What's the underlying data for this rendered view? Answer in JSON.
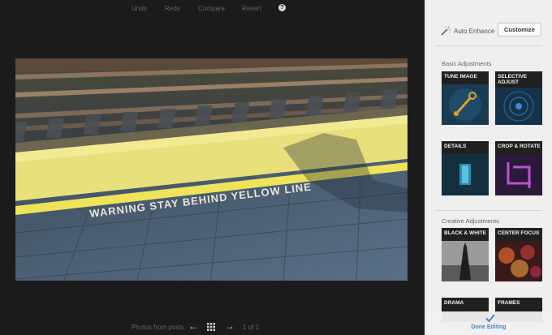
{
  "toolbar": {
    "undo": "Undo",
    "redo": "Redo",
    "compare": "Compare",
    "revert": "Revert",
    "help": "?"
  },
  "photo": {
    "stencil_text": "WARNING STAY BEHIND YELLOW LINE"
  },
  "bottom": {
    "photos_from_posts": "Photos from posts",
    "page_count": "1 of 1",
    "prev_icon": "arrow-left-icon",
    "grid_icon": "grid-icon",
    "next_icon": "arrow-right-icon"
  },
  "panel": {
    "auto_enhance": "Auto Enhance",
    "auto_enhance_icon": "magic-wand-icon",
    "customize": "Customize",
    "basic_title": "Basic Adjustments",
    "creative_title": "Creative Adjustments",
    "basic_tiles": [
      {
        "label": "TUNE IMAGE"
      },
      {
        "label": "SELECTIVE\nADJUST"
      },
      {
        "label": "DETAILS"
      },
      {
        "label": "CROP & ROTATE"
      }
    ],
    "creative_tiles": [
      {
        "label": "BLACK & WHITE"
      },
      {
        "label": "CENTER FOCUS"
      },
      {
        "label": "DRAMA"
      },
      {
        "label": "FRAMES"
      }
    ],
    "done": "Done Editing",
    "accent": "#4a7fd0"
  }
}
